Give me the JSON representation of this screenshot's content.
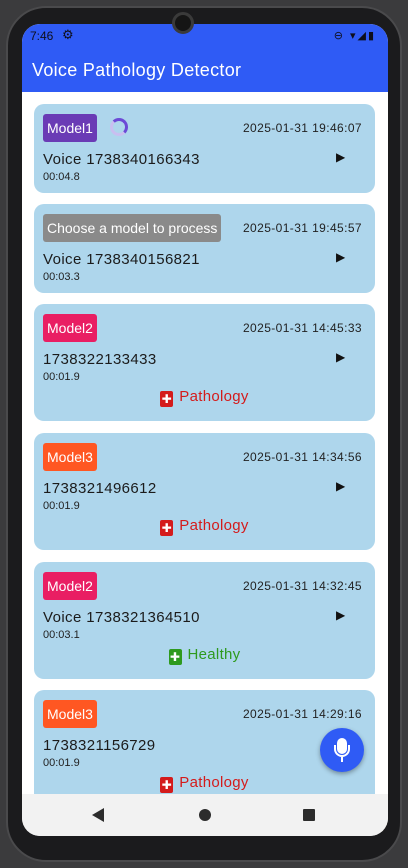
{
  "status_bar": {
    "time": "7:46",
    "gear_icon": "⚙",
    "right_icons": "⊖ ▾◢▮"
  },
  "app": {
    "title": "Voice Pathology Detector"
  },
  "colors": {
    "primary": "#2f5bf5",
    "card_bg": "#aed6ec",
    "model1": "#6a3bb5",
    "model2": "#e91e63",
    "model3": "#ff5722",
    "pending": "#8a8a8a",
    "pathology": "#d41b1b",
    "healthy": "#2e9a1e"
  },
  "recordings": [
    {
      "model": "Model1",
      "timestamp": "2025-01-31 19:46:07",
      "name": "Voice 1738340166343",
      "duration": "00:04.8",
      "result": "",
      "processing": true
    },
    {
      "model": "Choose a model to process",
      "timestamp": "2025-01-31 19:45:57",
      "name": "Voice 1738340156821",
      "duration": "00:03.3",
      "result": ""
    },
    {
      "model": "Model2",
      "timestamp": "2025-01-31 14:45:33",
      "name": "1738322133433",
      "duration": "00:01.9",
      "result": "Pathology"
    },
    {
      "model": "Model3",
      "timestamp": "2025-01-31 14:34:56",
      "name": "1738321496612",
      "duration": "00:01.9",
      "result": "Pathology"
    },
    {
      "model": "Model2",
      "timestamp": "2025-01-31 14:32:45",
      "name": "Voice 1738321364510",
      "duration": "00:03.1",
      "result": "Healthy"
    },
    {
      "model": "Model3",
      "timestamp": "2025-01-31 14:29:16",
      "name": "1738321156729",
      "duration": "00:01.9",
      "result": "Pathology"
    }
  ],
  "icons": {
    "play": "▶",
    "result": "✚",
    "fab": "mic-icon"
  }
}
